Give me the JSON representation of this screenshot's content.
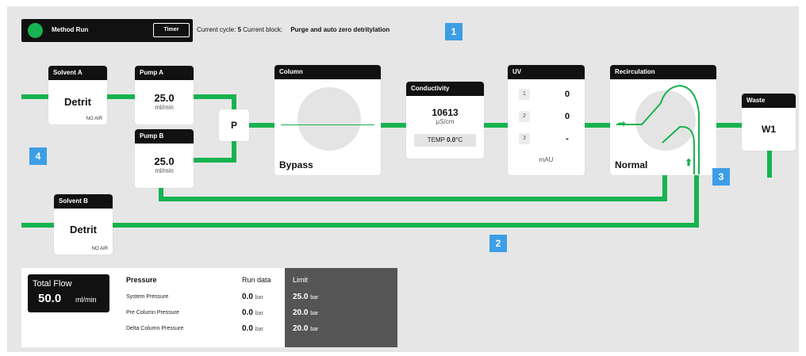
{
  "topbar": {
    "status_label": "Method Run",
    "timer_label": "Timer",
    "cycle_prefix": "Current cycle:",
    "cycle_value": "5",
    "block_prefix": "Current block:",
    "block_value": "Purge and auto zero detritylation"
  },
  "badges": [
    "1",
    "2",
    "3",
    "4"
  ],
  "solvent_a": {
    "title": "Solvent A",
    "value": "Detrit",
    "status": "NO AIR"
  },
  "solvent_b": {
    "title": "Solvent B",
    "value": "Detrit",
    "status": "NO AIR"
  },
  "pump_a": {
    "title": "Pump A",
    "value": "25.0",
    "unit": "ml/min"
  },
  "pump_b": {
    "title": "Pump B",
    "value": "25.0",
    "unit": "ml/min"
  },
  "mixer": {
    "label": "P"
  },
  "column": {
    "title": "Column",
    "state": "Bypass"
  },
  "conductivity": {
    "title": "Conductivity",
    "value": "10613",
    "unit": "µS/cm",
    "temp_label": "TEMP",
    "temp_value": "0.0",
    "temp_unit": "°C"
  },
  "uv": {
    "title": "UV",
    "channels": [
      {
        "num": "1",
        "value": "0"
      },
      {
        "num": "2",
        "value": "0"
      },
      {
        "num": "3",
        "value": "-"
      }
    ],
    "unit": "mAU"
  },
  "recirculation": {
    "title": "Recirculation",
    "state": "Normal"
  },
  "waste": {
    "title": "Waste",
    "value": "W1"
  },
  "flow": {
    "label": "Total Flow",
    "value": "50.0",
    "unit": "ml/min"
  },
  "pressure": {
    "header": "Pressure",
    "run_header": "Run data",
    "limit_header": "Limit",
    "rows": [
      {
        "name": "System Pressure",
        "run": "0.0",
        "run_unit": "bar",
        "limit": "25.0",
        "limit_unit": "bar"
      },
      {
        "name": "Pre Column Pressure",
        "run": "0.0",
        "run_unit": "bar",
        "limit": "20.0",
        "limit_unit": "bar"
      },
      {
        "name": "Delta Column Pressure",
        "run": "0.0",
        "run_unit": "bar",
        "limit": "20.0",
        "limit_unit": "bar"
      }
    ]
  },
  "colors": {
    "flow": "#17b350",
    "badge": "#3d9ee6",
    "header": "#111111",
    "limit_bg": "#555555"
  }
}
